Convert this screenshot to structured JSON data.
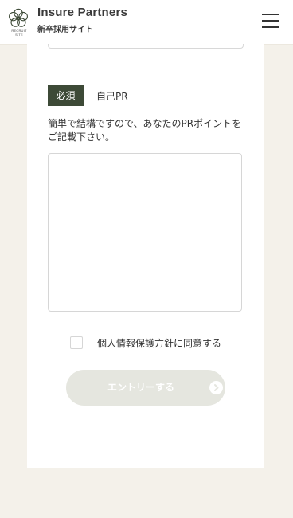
{
  "header": {
    "logo_subtext": "RECRUIT SITE",
    "title": "Insure Partners",
    "subtitle": "新卒採用サイト",
    "menu_icon": "hamburger-menu-icon"
  },
  "form": {
    "required_badge": "必須",
    "field_label": "自己PR",
    "description": "簡単で結構ですので、あなたのPRポイントをご記載下さい。",
    "textarea_value": "",
    "consent_text": "個人情報保護方針に同意する",
    "consent_checked": false,
    "submit_label": "エントリーする",
    "submit_icon": "arrow-right-circle-icon"
  },
  "colors": {
    "page_background": "#f4f1ea",
    "badge_background": "#3d4a37",
    "button_disabled": "#e5e6df"
  }
}
